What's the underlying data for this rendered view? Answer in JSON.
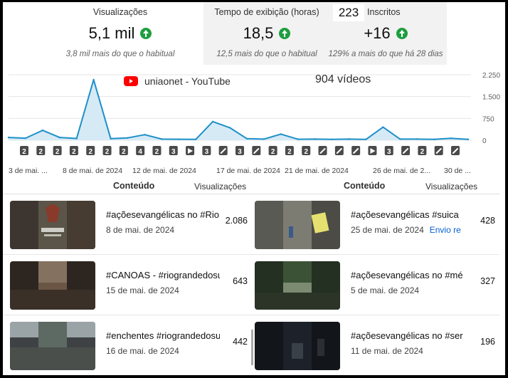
{
  "metrics": {
    "views": {
      "label": "Visualizações",
      "value": "5,1 mil",
      "note": "3,8 mil mais do que o habitual"
    },
    "watch_time": {
      "label": "Tempo de exibição (horas)",
      "value": "18,5",
      "note": "12,5 mais do que o habitual"
    },
    "subscribers": {
      "count": "223",
      "label": "Inscritos",
      "value": "+16",
      "note": "129% a mais do que há 28 dias"
    }
  },
  "channel": {
    "name": "uniaonet - YouTube",
    "video_count": "904 vídeos"
  },
  "colors": {
    "line": "#1e90c8",
    "fill": "#d6eaf6",
    "up": "#1e9e3e",
    "marker": "#4a4a4a"
  },
  "chart_data": {
    "type": "area",
    "y_ticks": [
      "2.250",
      "1.500",
      "750",
      "0"
    ],
    "ylim": [
      0,
      2250
    ],
    "values": [
      95,
      70,
      340,
      95,
      60,
      2080,
      55,
      80,
      190,
      40,
      35,
      30,
      640,
      430,
      55,
      40,
      210,
      35,
      40,
      30,
      40,
      30,
      450,
      40,
      40,
      30,
      65,
      30
    ],
    "x_labels": [
      "3 de mai. ...",
      "8 de mai. de 2024",
      "12 de mai. de 2024",
      "17 de mai. de 2024",
      "21 de mai. de 2024",
      "26 de mai. de 2...",
      "30 de ..."
    ],
    "markers": [
      "2",
      "2",
      "2",
      "2",
      "2",
      "2",
      "2",
      "4",
      "2",
      "3",
      "play",
      "3",
      "link",
      "3",
      "link",
      "2",
      "2",
      "2",
      "link",
      "link",
      "link",
      "play",
      "3",
      "link",
      "2",
      "link",
      "link"
    ]
  },
  "left_table": {
    "col_content": "Conteúdo",
    "col_views": "Visualizações",
    "rows": [
      {
        "title": "#açõesevangélicas no #Rio",
        "date": "8 de mai. de 2024",
        "views": "2.086"
      },
      {
        "title": "#CANOAS - #riograndedosul",
        "date": "15 de mai. de 2024",
        "views": "643"
      },
      {
        "title": "#enchentes #riograndedosul",
        "date": "16 de mai. de 2024",
        "views": "442"
      }
    ]
  },
  "right_table": {
    "col_content": "Conteúdo",
    "col_views": "Visualizações",
    "rows": [
      {
        "title": "#açõesevangélicas #suica",
        "date": "25 de mai. de 2024",
        "extra": "Envio re",
        "views": "428"
      },
      {
        "title": "#açõesevangélicas no #mé",
        "date": "5 de mai. de 2024",
        "views": "327"
      },
      {
        "title": "#açõesevangélicas no #ser",
        "date": "11 de mai. de 2024",
        "views": "196"
      }
    ]
  }
}
